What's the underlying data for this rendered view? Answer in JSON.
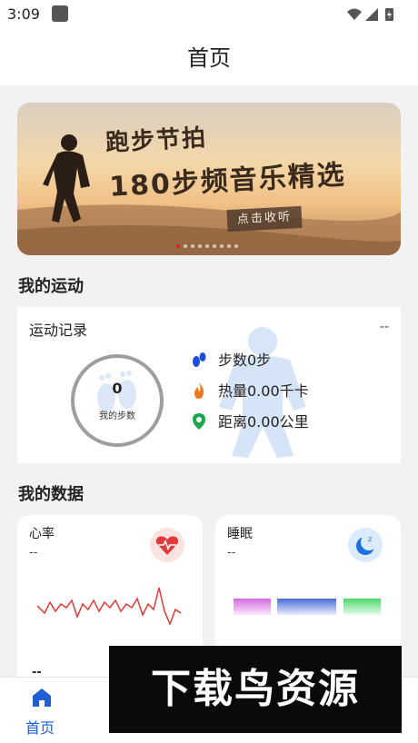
{
  "status": {
    "time": "3:09"
  },
  "header": {
    "title": "首页"
  },
  "banner": {
    "line1": "跑步节拍",
    "line2": "180步频音乐精选",
    "cta": "点击收听",
    "dot_count": 9,
    "active_index": 0
  },
  "sport": {
    "section_title": "我的运动",
    "record_title": "运动记录",
    "record_value": "--",
    "steps_value": "0",
    "steps_label": "我的步数",
    "stats": [
      {
        "icon": "footprints-icon",
        "text": "步数0步",
        "color": "#1f4fd8"
      },
      {
        "icon": "flame-icon",
        "text": "热量0.00千卡",
        "color": "#f07a1a"
      },
      {
        "icon": "location-pin-icon",
        "text": "距离0.00公里",
        "color": "#1aa84a"
      }
    ]
  },
  "data_section": {
    "title": "我的数据",
    "heart": {
      "title": "心率",
      "value": "--",
      "bottom_value": "--",
      "color": "#e23a3a"
    },
    "sleep": {
      "title": "睡眠",
      "value": "--",
      "color": "#1f6fe0"
    }
  },
  "nav": {
    "home_label": "首页",
    "active_color": "#1f5fd1"
  },
  "watermark": {
    "text": "下载鸟资源"
  }
}
